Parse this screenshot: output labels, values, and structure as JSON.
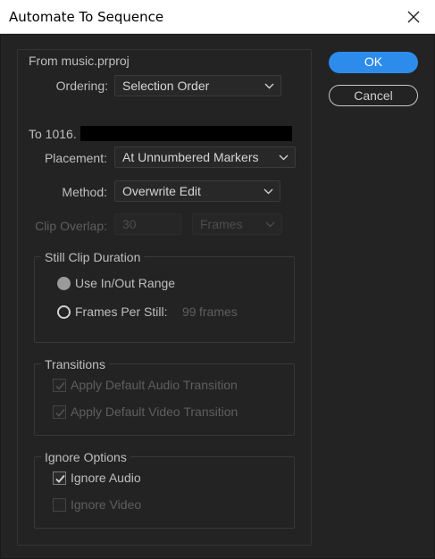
{
  "window": {
    "title": "Automate To Sequence"
  },
  "from": {
    "heading": "From music.prproj",
    "ordering_label": "Ordering:",
    "ordering_value": "Selection Order"
  },
  "to": {
    "heading": "To 1016.",
    "placement_label": "Placement:",
    "placement_value": "At Unnumbered Markers",
    "method_label": "Method:",
    "method_value": "Overwrite Edit",
    "clip_overlap_label": "Clip Overlap:",
    "clip_overlap_value": "30",
    "clip_overlap_unit": "Frames"
  },
  "still_clip": {
    "title": "Still Clip Duration",
    "use_inout_label": "Use In/Out Range",
    "frames_per_still_label": "Frames Per Still:",
    "frames_per_still_value": "99",
    "frames_unit": "frames"
  },
  "transitions": {
    "title": "Transitions",
    "audio_label": "Apply Default Audio Transition",
    "video_label": "Apply Default Video Transition"
  },
  "ignore": {
    "title": "Ignore Options",
    "audio_label": "Ignore Audio",
    "video_label": "Ignore Video"
  },
  "buttons": {
    "ok": "OK",
    "cancel": "Cancel"
  },
  "colors": {
    "accent": "#2d8ceb",
    "background": "#232323"
  }
}
